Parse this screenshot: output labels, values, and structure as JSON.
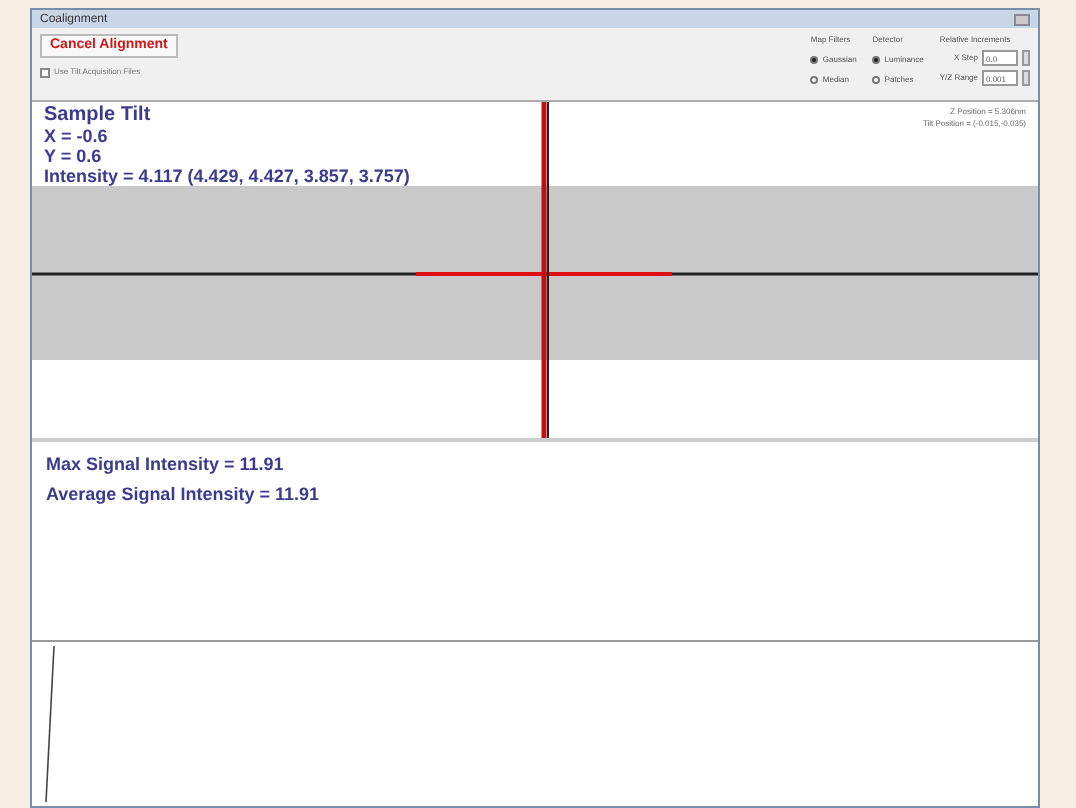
{
  "window": {
    "title": "Coalignment"
  },
  "cancel_button": "Cancel Alignment",
  "checkbox": {
    "label": "Use Tilt Acquisition Files",
    "checked": false
  },
  "option_groups": [
    {
      "title": "Map Filters",
      "options": [
        {
          "label": "Gaussian",
          "selected": true
        },
        {
          "label": "Median",
          "selected": false
        }
      ]
    },
    {
      "title": "Detector",
      "options": [
        {
          "label": "Luminance",
          "selected": true
        },
        {
          "label": "Patches",
          "selected": false
        }
      ]
    }
  ],
  "increments": {
    "title": "Relative Increments",
    "fields": [
      {
        "label": "X Step",
        "value": "0.0"
      },
      {
        "label": "Y/Z Range",
        "value": "0.001"
      }
    ]
  },
  "tilt_panel": {
    "lines": [
      "Sample Tilt",
      "X = -0.6",
      "Y = 0.6",
      "Intensity = 4.117 (4.429, 4.427, 3.857, 3.757)"
    ],
    "info": [
      "Z Position = 5.306nm",
      "Tilt Position = (-0.015,-0.035)"
    ]
  },
  "signal_panel": {
    "lines": [
      "Max Signal Intensity = 11.91",
      "Average Signal Intensity = 11.91"
    ]
  }
}
